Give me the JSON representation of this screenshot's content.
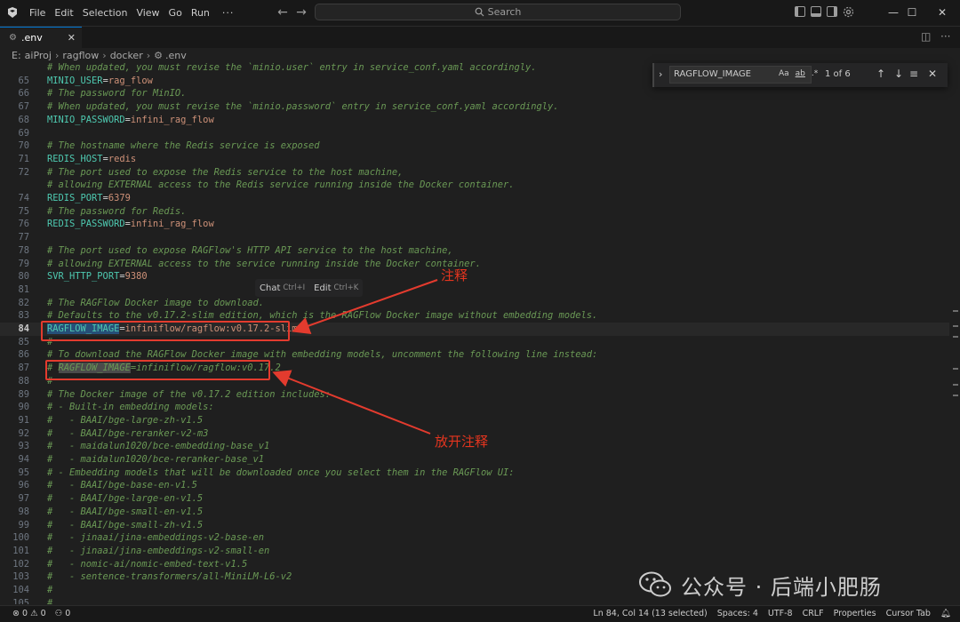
{
  "titlebar": {
    "menu": [
      "File",
      "Edit",
      "Selection",
      "View",
      "Go",
      "Run"
    ],
    "more": "···",
    "search_placeholder": "Search",
    "back": "←",
    "forward": "→",
    "minimize": "—",
    "maximize": "☐",
    "close": "✕"
  },
  "tab": {
    "label": ".env",
    "close": "✕"
  },
  "breadcrumb": {
    "items": [
      "E:",
      "aiProj",
      "ragflow",
      "docker",
      ".env"
    ]
  },
  "find": {
    "query": "RAGFLOW_IMAGE",
    "count": "1 of 6",
    "opt_case": "Aa",
    "opt_word": "ab",
    "opt_regex": ".*"
  },
  "inline_hint": {
    "chat": "Chat",
    "chat_key": "Ctrl+I",
    "edit": "Edit",
    "edit_key": "Ctrl+K"
  },
  "annotations": {
    "comment_label": "注释",
    "uncomment_label": "放开注释"
  },
  "watermark": {
    "text": "公众号 · 后端小肥肠"
  },
  "status": {
    "errors": "0",
    "warnings": "0",
    "ports": "0",
    "position": "Ln 84, Col 14 (13 selected)",
    "spaces": "Spaces: 4",
    "encoding": "UTF-8",
    "eol": "CRLF",
    "properties": "Properties",
    "cursor_tab": "Cursor Tab"
  },
  "editor": {
    "lines": [
      {
        "n": "",
        "type": "comment",
        "text": "# When updated, you must revise the `minio.user` entry in service_conf.yaml accordingly."
      },
      {
        "n": "65",
        "type": "kv",
        "key": "MINIO_USER",
        "value": "rag_flow"
      },
      {
        "n": "66",
        "type": "comment",
        "text": "# The password for MinIO."
      },
      {
        "n": "67",
        "type": "comment",
        "text": "# When updated, you must revise the `minio.password` entry in service_conf.yaml accordingly."
      },
      {
        "n": "68",
        "type": "kv",
        "key": "MINIO_PASSWORD",
        "value": "infini_rag_flow"
      },
      {
        "n": "69",
        "type": "blank"
      },
      {
        "n": "70",
        "type": "comment",
        "text": "# The hostname where the Redis service is exposed"
      },
      {
        "n": "71",
        "type": "kv",
        "key": "REDIS_HOST",
        "value": "redis"
      },
      {
        "n": "72",
        "type": "comment",
        "text": "# The port used to expose the Redis service to the host machine,"
      },
      {
        "n": "",
        "type": "comment",
        "text": "# allowing EXTERNAL access to the Redis service running inside the Docker container."
      },
      {
        "n": "74",
        "type": "kv",
        "key": "REDIS_PORT",
        "value": "6379"
      },
      {
        "n": "75",
        "type": "comment",
        "text": "# The password for Redis."
      },
      {
        "n": "76",
        "type": "kv",
        "key": "REDIS_PASSWORD",
        "value": "infini_rag_flow"
      },
      {
        "n": "77",
        "type": "blank"
      },
      {
        "n": "78",
        "type": "comment",
        "text": "# The port used to expose RAGFlow's HTTP API service to the host machine,"
      },
      {
        "n": "79",
        "type": "comment",
        "text": "# allowing EXTERNAL access to the service running inside the Docker container."
      },
      {
        "n": "80",
        "type": "kv",
        "key": "SVR_HTTP_PORT",
        "value": "9380"
      },
      {
        "n": "81",
        "type": "blank"
      },
      {
        "n": "82",
        "type": "comment",
        "text": "# The RAGFlow Docker image to download."
      },
      {
        "n": "83",
        "type": "comment",
        "text": "# Defaults to the v0.17.2-slim edition, which is the RAGFlow Docker image without embedding models."
      },
      {
        "n": "84",
        "type": "kv_hl",
        "key": "RAGFLOW_IMAGE",
        "value": "infiniflow/ragflow:v0.17.2-slim"
      },
      {
        "n": "85",
        "type": "comment",
        "text": "#"
      },
      {
        "n": "86",
        "type": "comment",
        "text": "# To download the RAGFlow Docker image with embedding models, uncomment the following line instead:"
      },
      {
        "n": "87",
        "type": "commented_kv",
        "key": "RAGFLOW_IMAGE",
        "value": "infiniflow/ragflow:v0.17.2"
      },
      {
        "n": "88",
        "type": "comment",
        "text": "#"
      },
      {
        "n": "89",
        "type": "comment",
        "text": "# The Docker image of the v0.17.2 edition includes:"
      },
      {
        "n": "90",
        "type": "comment",
        "text": "# - Built-in embedding models:"
      },
      {
        "n": "91",
        "type": "comment",
        "text": "#   - BAAI/bge-large-zh-v1.5"
      },
      {
        "n": "92",
        "type": "comment",
        "text": "#   - BAAI/bge-reranker-v2-m3"
      },
      {
        "n": "93",
        "type": "comment",
        "text": "#   - maidalun1020/bce-embedding-base_v1"
      },
      {
        "n": "94",
        "type": "comment",
        "text": "#   - maidalun1020/bce-reranker-base_v1"
      },
      {
        "n": "95",
        "type": "comment",
        "text": "# - Embedding models that will be downloaded once you select them in the RAGFlow UI:"
      },
      {
        "n": "96",
        "type": "comment",
        "text": "#   - BAAI/bge-base-en-v1.5"
      },
      {
        "n": "97",
        "type": "comment",
        "text": "#   - BAAI/bge-large-en-v1.5"
      },
      {
        "n": "98",
        "type": "comment",
        "text": "#   - BAAI/bge-small-en-v1.5"
      },
      {
        "n": "99",
        "type": "comment",
        "text": "#   - BAAI/bge-small-zh-v1.5"
      },
      {
        "n": "100",
        "type": "comment",
        "text": "#   - jinaai/jina-embeddings-v2-base-en"
      },
      {
        "n": "101",
        "type": "comment",
        "text": "#   - jinaai/jina-embeddings-v2-small-en"
      },
      {
        "n": "102",
        "type": "comment",
        "text": "#   - nomic-ai/nomic-embed-text-v1.5"
      },
      {
        "n": "103",
        "type": "comment",
        "text": "#   - sentence-transformers/all-MiniLM-L6-v2"
      },
      {
        "n": "104",
        "type": "comment",
        "text": "#"
      },
      {
        "n": "105",
        "type": "comment",
        "text": "#"
      }
    ]
  }
}
